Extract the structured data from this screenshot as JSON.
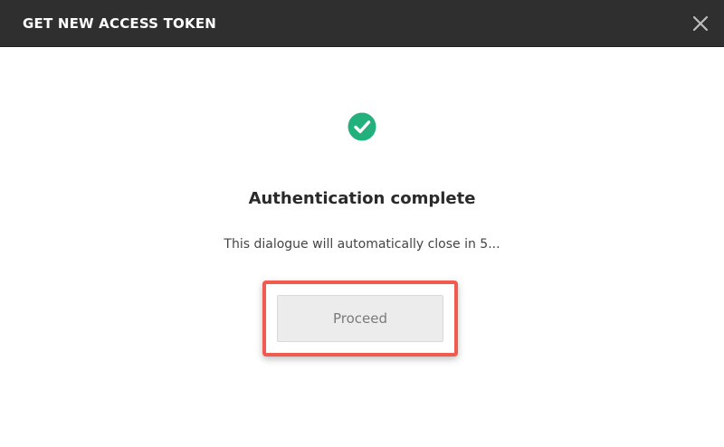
{
  "dialog": {
    "title": "GET NEW ACCESS TOKEN",
    "close_icon": "close-icon",
    "success_icon": "check-circle-icon",
    "heading": "Authentication complete",
    "message": "This dialogue will automatically close in 5...",
    "proceed_label": "Proceed"
  },
  "colors": {
    "titlebar": "#2f2f2f",
    "success": "#22b07d",
    "highlight": "#f05a4f",
    "button_bg": "#ececec",
    "button_text": "#7a7a7a"
  }
}
